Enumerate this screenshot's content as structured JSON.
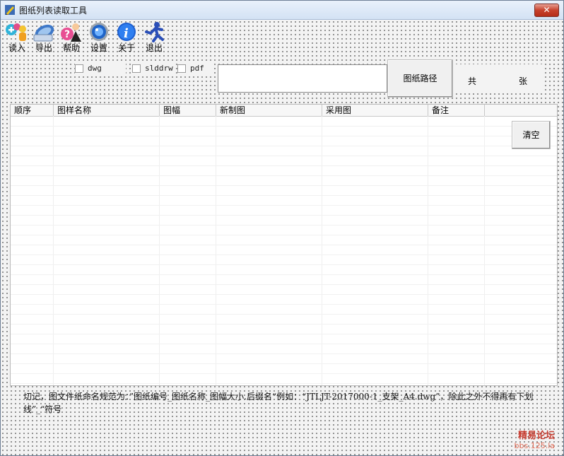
{
  "window": {
    "title": "图纸列表读取工具",
    "close_glyph": "✕"
  },
  "toolbar": {
    "items": [
      {
        "label": "读入",
        "icon": "users-add-icon"
      },
      {
        "label": "导出",
        "icon": "export-icon"
      },
      {
        "label": "帮助",
        "icon": "help-icon"
      },
      {
        "label": "设置",
        "icon": "settings-icon"
      },
      {
        "label": "关于",
        "icon": "about-icon"
      },
      {
        "label": "退出",
        "icon": "exit-icon"
      }
    ]
  },
  "filters": {
    "dwg": "dwg",
    "slddrw": "slddrw",
    "pdf": "pdf"
  },
  "path": {
    "value": "",
    "button": "图纸路径"
  },
  "count": {
    "prefix": "共",
    "value": "",
    "suffix": "张"
  },
  "grid": {
    "columns": [
      "顺序",
      "图样名称",
      "图幅",
      "新制图",
      "采用图",
      "备注"
    ],
    "rows": []
  },
  "clear_button": "清空",
  "note": "切记，图文件纸命名规范为：”图纸编号_图纸名称_图幅大小.后缀名“例如：“JTLJT-2017000-1_支架_A4.dwg”，除此之外不得再有下划线”_“符号",
  "watermark": {
    "line1": "精易论坛",
    "line2": "bbs.125.la"
  },
  "colors": {
    "accent": "#c7412c",
    "titlebar": "#dbe7f5",
    "background": "#f3f3f3"
  }
}
